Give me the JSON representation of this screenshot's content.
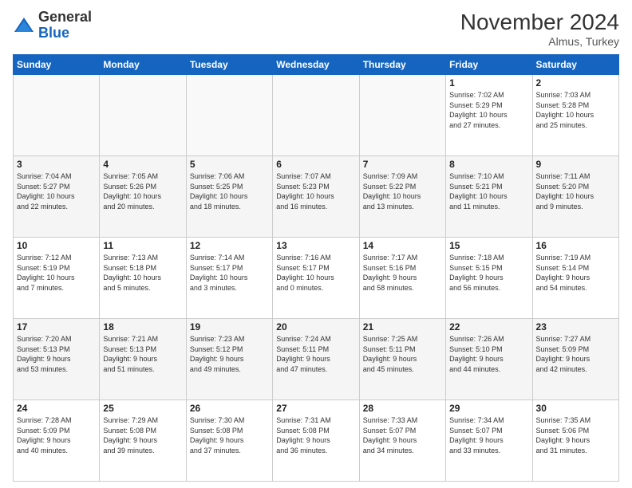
{
  "header": {
    "logo_line1": "General",
    "logo_line2": "Blue",
    "month_year": "November 2024",
    "location": "Almus, Turkey"
  },
  "weekdays": [
    "Sunday",
    "Monday",
    "Tuesday",
    "Wednesday",
    "Thursday",
    "Friday",
    "Saturday"
  ],
  "weeks": [
    [
      {
        "day": "",
        "info": ""
      },
      {
        "day": "",
        "info": ""
      },
      {
        "day": "",
        "info": ""
      },
      {
        "day": "",
        "info": ""
      },
      {
        "day": "",
        "info": ""
      },
      {
        "day": "1",
        "info": "Sunrise: 7:02 AM\nSunset: 5:29 PM\nDaylight: 10 hours\nand 27 minutes."
      },
      {
        "day": "2",
        "info": "Sunrise: 7:03 AM\nSunset: 5:28 PM\nDaylight: 10 hours\nand 25 minutes."
      }
    ],
    [
      {
        "day": "3",
        "info": "Sunrise: 7:04 AM\nSunset: 5:27 PM\nDaylight: 10 hours\nand 22 minutes."
      },
      {
        "day": "4",
        "info": "Sunrise: 7:05 AM\nSunset: 5:26 PM\nDaylight: 10 hours\nand 20 minutes."
      },
      {
        "day": "5",
        "info": "Sunrise: 7:06 AM\nSunset: 5:25 PM\nDaylight: 10 hours\nand 18 minutes."
      },
      {
        "day": "6",
        "info": "Sunrise: 7:07 AM\nSunset: 5:23 PM\nDaylight: 10 hours\nand 16 minutes."
      },
      {
        "day": "7",
        "info": "Sunrise: 7:09 AM\nSunset: 5:22 PM\nDaylight: 10 hours\nand 13 minutes."
      },
      {
        "day": "8",
        "info": "Sunrise: 7:10 AM\nSunset: 5:21 PM\nDaylight: 10 hours\nand 11 minutes."
      },
      {
        "day": "9",
        "info": "Sunrise: 7:11 AM\nSunset: 5:20 PM\nDaylight: 10 hours\nand 9 minutes."
      }
    ],
    [
      {
        "day": "10",
        "info": "Sunrise: 7:12 AM\nSunset: 5:19 PM\nDaylight: 10 hours\nand 7 minutes."
      },
      {
        "day": "11",
        "info": "Sunrise: 7:13 AM\nSunset: 5:18 PM\nDaylight: 10 hours\nand 5 minutes."
      },
      {
        "day": "12",
        "info": "Sunrise: 7:14 AM\nSunset: 5:17 PM\nDaylight: 10 hours\nand 3 minutes."
      },
      {
        "day": "13",
        "info": "Sunrise: 7:16 AM\nSunset: 5:17 PM\nDaylight: 10 hours\nand 0 minutes."
      },
      {
        "day": "14",
        "info": "Sunrise: 7:17 AM\nSunset: 5:16 PM\nDaylight: 9 hours\nand 58 minutes."
      },
      {
        "day": "15",
        "info": "Sunrise: 7:18 AM\nSunset: 5:15 PM\nDaylight: 9 hours\nand 56 minutes."
      },
      {
        "day": "16",
        "info": "Sunrise: 7:19 AM\nSunset: 5:14 PM\nDaylight: 9 hours\nand 54 minutes."
      }
    ],
    [
      {
        "day": "17",
        "info": "Sunrise: 7:20 AM\nSunset: 5:13 PM\nDaylight: 9 hours\nand 53 minutes."
      },
      {
        "day": "18",
        "info": "Sunrise: 7:21 AM\nSunset: 5:13 PM\nDaylight: 9 hours\nand 51 minutes."
      },
      {
        "day": "19",
        "info": "Sunrise: 7:23 AM\nSunset: 5:12 PM\nDaylight: 9 hours\nand 49 minutes."
      },
      {
        "day": "20",
        "info": "Sunrise: 7:24 AM\nSunset: 5:11 PM\nDaylight: 9 hours\nand 47 minutes."
      },
      {
        "day": "21",
        "info": "Sunrise: 7:25 AM\nSunset: 5:11 PM\nDaylight: 9 hours\nand 45 minutes."
      },
      {
        "day": "22",
        "info": "Sunrise: 7:26 AM\nSunset: 5:10 PM\nDaylight: 9 hours\nand 44 minutes."
      },
      {
        "day": "23",
        "info": "Sunrise: 7:27 AM\nSunset: 5:09 PM\nDaylight: 9 hours\nand 42 minutes."
      }
    ],
    [
      {
        "day": "24",
        "info": "Sunrise: 7:28 AM\nSunset: 5:09 PM\nDaylight: 9 hours\nand 40 minutes."
      },
      {
        "day": "25",
        "info": "Sunrise: 7:29 AM\nSunset: 5:08 PM\nDaylight: 9 hours\nand 39 minutes."
      },
      {
        "day": "26",
        "info": "Sunrise: 7:30 AM\nSunset: 5:08 PM\nDaylight: 9 hours\nand 37 minutes."
      },
      {
        "day": "27",
        "info": "Sunrise: 7:31 AM\nSunset: 5:08 PM\nDaylight: 9 hours\nand 36 minutes."
      },
      {
        "day": "28",
        "info": "Sunrise: 7:33 AM\nSunset: 5:07 PM\nDaylight: 9 hours\nand 34 minutes."
      },
      {
        "day": "29",
        "info": "Sunrise: 7:34 AM\nSunset: 5:07 PM\nDaylight: 9 hours\nand 33 minutes."
      },
      {
        "day": "30",
        "info": "Sunrise: 7:35 AM\nSunset: 5:06 PM\nDaylight: 9 hours\nand 31 minutes."
      }
    ]
  ]
}
